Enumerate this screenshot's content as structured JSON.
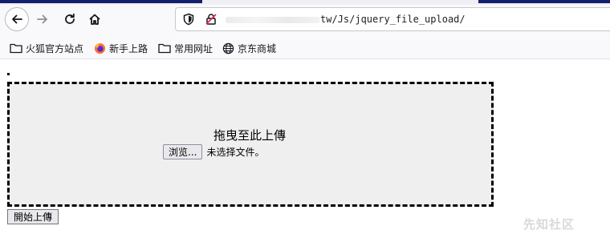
{
  "browser": {
    "url": "tw/Js/jquery_file_upload/",
    "bookmarks": [
      {
        "label": "火狐官方站点",
        "icon": "folder-icon"
      },
      {
        "label": "新手上路",
        "icon": "firefox-icon"
      },
      {
        "label": "常用网址",
        "icon": "folder-icon"
      },
      {
        "label": "京东商城",
        "icon": "globe-icon"
      }
    ]
  },
  "page": {
    "drop_text": "拖曳至此上傳",
    "browse_label": "浏览...",
    "no_file_text": "未选择文件。",
    "upload_label": "開始上傳"
  },
  "watermark": "先知社区",
  "colors": {
    "accent": "#13206b",
    "drop_zone_bg": "#efefef"
  }
}
